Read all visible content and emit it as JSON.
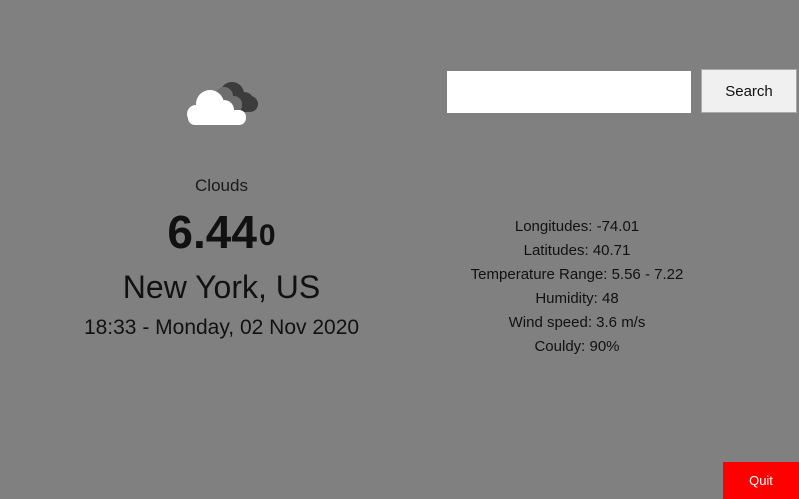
{
  "weather": {
    "icon": "clouds-icon",
    "condition": "Clouds",
    "temperature": "6.44",
    "degree_symbol": "0",
    "city": "New York, US",
    "datetime": "18:33 - Monday, 02 Nov 2020"
  },
  "search": {
    "value": "",
    "placeholder": "",
    "button_label": "Search"
  },
  "details": [
    "Longitudes: -74.01",
    "Latitudes: 40.71",
    "Temperature Range: 5.56 - 7.22",
    "Humidity: 48",
    "Wind speed: 3.6 m/s",
    "Couldy: 90%"
  ],
  "quit": {
    "label": "Quit"
  },
  "colors": {
    "background": "#808080",
    "quit_button": "#ff0000",
    "quit_text": "#ffffff"
  }
}
